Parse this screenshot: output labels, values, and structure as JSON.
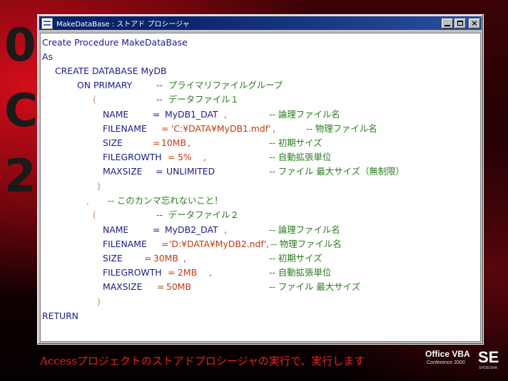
{
  "slide": {
    "big_chars": [
      "0",
      "C",
      "2"
    ],
    "caption": "Accessプロジェクトのストアドプロシージャの実行で、実行します",
    "logo": {
      "office": "Office VBA",
      "conference": "Conference 2000",
      "brand": "SE",
      "publisher": "SHOEISHA"
    }
  },
  "window": {
    "title": "MakeDataBase : ストアド プロシージャ",
    "icon": "stored-procedure-icon",
    "controls": [
      "minimize",
      "maximize",
      "close"
    ]
  },
  "code": {
    "l1": "Create Procedure MakeDataBase",
    "l2": "As",
    "l3": "CREATE DATABASE MyDB",
    "l4_kw": "ON PRIMARY",
    "l4_cm": "--  プライマリファイルグループ",
    "l5_p": "(",
    "l5_cm": "--  データファイル１",
    "name1_kw": "NAME",
    "name1_eq": "=",
    "name1_val": "MyDB1_DAT",
    "name1_comma": ",",
    "name1_cm": "-- 論理ファイル名",
    "file1_kw": "FILENAME",
    "file1_eq": "=",
    "file1_val": "'C:¥DATA¥MyDB1.mdf'",
    "file1_comma": ",",
    "file1_cm": "-- 物理ファイル名",
    "size1_kw": "SIZE",
    "size1_eq": "=",
    "size1_val": "10MB",
    "size1_comma": ",",
    "size1_cm": "-- 初期サイズ",
    "grow1_kw": "FILEGROWTH",
    "grow1_eq": "=",
    "grow1_val": "5%",
    "grow1_comma": ",",
    "grow1_cm": "-- 自動拡張単位",
    "max1_kw": "MAXSIZE",
    "max1_eq": "=",
    "max1_val": "UNLIMITED",
    "max1_cm": "-- ファイル 最大サイズ（無制限）",
    "close1": ")",
    "sep_comma": ",",
    "sep_cm": "-- このカンマ忘れないこと！",
    "l16_p": "(",
    "l16_cm": "--  データファイル２",
    "name2_kw": "NAME",
    "name2_eq": "=",
    "name2_val": "MyDB2_DAT",
    "name2_comma": ",",
    "name2_cm": "-- 論理ファイル名",
    "file2_kw": "FILENAME",
    "file2_eq": "=",
    "file2_val": "'D:¥DATA¥MyDB2.ndf',",
    "file2_cm": "-- 物理ファイル名",
    "size2_kw": "SIZE",
    "size2_eq": "=",
    "size2_val": "30MB",
    "size2_comma": ",",
    "size2_cm": "-- 初期サイズ",
    "grow2_kw": "FILEGROWTH",
    "grow2_eq": "=",
    "grow2_val": "2MB",
    "grow2_comma": ",",
    "grow2_cm": "-- 自動拡張単位",
    "max2_kw": "MAXSIZE",
    "max2_eq": "=",
    "max2_val": "50MB",
    "max2_cm": "-- ファイル 最大サイズ",
    "close2": ")",
    "return": "RETURN"
  },
  "colors": {
    "keyword": "#1b1b8a",
    "value": "#c03a10",
    "comment": "#2a7a1e",
    "titlebar": "#0a246a",
    "caption": "#e0262a"
  }
}
